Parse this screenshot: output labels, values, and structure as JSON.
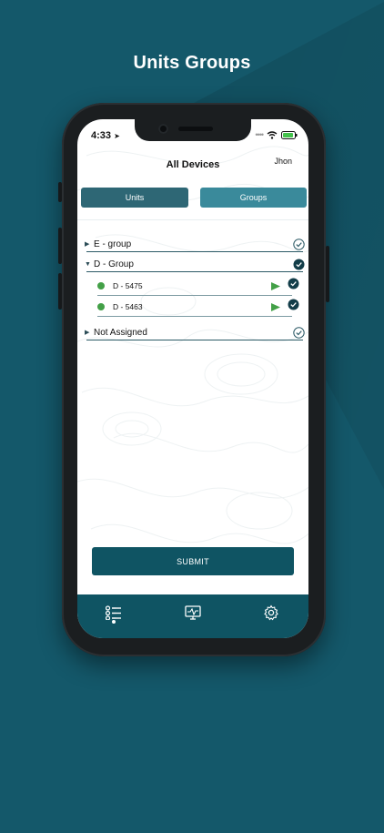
{
  "promo_title": "Units Groups",
  "status_bar": {
    "time": "4:33"
  },
  "header": {
    "title": "All Devices",
    "user": "Jhon"
  },
  "tabs": [
    {
      "label": "Units",
      "active": false
    },
    {
      "label": "Groups",
      "active": true
    }
  ],
  "groups": [
    {
      "label": "E - group",
      "expanded": false,
      "checked": false
    },
    {
      "label": "D - Group",
      "expanded": true,
      "checked": true
    },
    {
      "label": "Not Assigned",
      "expanded": false,
      "checked": false
    }
  ],
  "devices": [
    {
      "label": "D - 5475",
      "status": "online",
      "checked": true
    },
    {
      "label": "D - 5463",
      "status": "online",
      "checked": true
    }
  ],
  "submit_label": "SUBMIT",
  "bottom_nav": [
    {
      "icon": "list-icon",
      "active": true
    },
    {
      "icon": "monitor-icon",
      "active": false
    },
    {
      "icon": "gear-icon",
      "active": false
    }
  ],
  "colors": {
    "background": "#14586a",
    "primary": "#0f5463",
    "tab_units": "#2e6775",
    "tab_groups": "#3a8a9b",
    "status_online": "#43a047"
  }
}
